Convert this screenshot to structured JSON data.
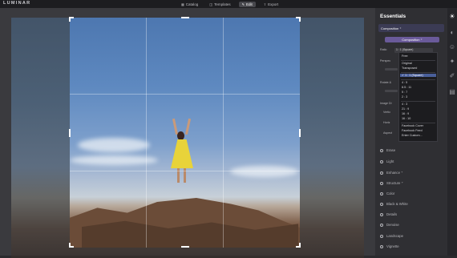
{
  "app": {
    "logo": "LUMINAR"
  },
  "topbar": {
    "tabs": [
      {
        "label": "Catalog",
        "icon": "grid-icon"
      },
      {
        "label": "Templates",
        "icon": "templates-icon"
      },
      {
        "label": "Edit",
        "icon": "edit-icon",
        "active": true
      },
      {
        "label": "Export",
        "icon": "export-icon"
      }
    ]
  },
  "panel": {
    "title": "Essentials",
    "composition_label": "Composition ⁺",
    "composition_button": "Composition ⁺",
    "ratio_label": "Ratio",
    "ratio_value": "1 : 1 (Square)",
    "perspective_label": "Perspec",
    "rotate_label": "Rotate &",
    "image_label": "Image Di",
    "vertical_label": "Vertic",
    "horizontal_label": "Horiz",
    "aspect_label": "Aspect"
  },
  "ratio_menu": {
    "items": [
      "Free",
      "Original",
      "Transposed",
      "1 : 1 (Square)",
      "4 : 5",
      "8.5 : 11",
      "5 : 7",
      "2 : 3",
      "4 : 3",
      "21 : 9",
      "16 : 9",
      "16 : 10",
      "Facebook Cover",
      "Facebook Feed",
      "Enter Custom..."
    ],
    "selected": "1 : 1 (Square)"
  },
  "tools": [
    {
      "label": "Erase"
    },
    {
      "label": "Light"
    },
    {
      "label": "Enhance ⁺"
    },
    {
      "label": "Structure ⁺"
    },
    {
      "label": "Color"
    },
    {
      "label": "Black & White"
    },
    {
      "label": "Details"
    },
    {
      "label": "Denoise"
    },
    {
      "label": "Landscape"
    },
    {
      "label": "Vignette"
    }
  ],
  "rail_icons": [
    "sun-icon",
    "palette-icon",
    "face-icon",
    "star-icon",
    "brush-icon",
    "layers-icon"
  ]
}
